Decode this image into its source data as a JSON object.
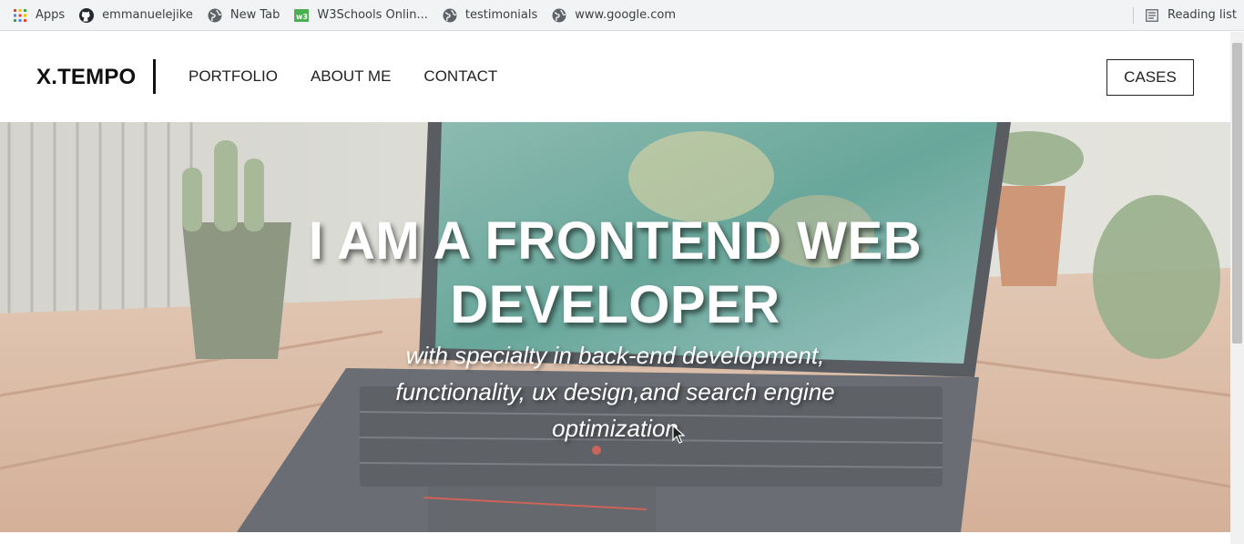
{
  "bookmarks": {
    "items": [
      {
        "label": "Apps",
        "icon": "apps-grid-icon"
      },
      {
        "label": "emmanuelejike",
        "icon": "github-icon"
      },
      {
        "label": "New Tab",
        "icon": "globe-icon"
      },
      {
        "label": "W3Schools Onlin...",
        "icon": "w3schools-icon"
      },
      {
        "label": "testimonials",
        "icon": "globe-icon"
      },
      {
        "label": "www.google.com",
        "icon": "globe-icon"
      }
    ],
    "reading_list": {
      "label": "Reading list",
      "icon": "reading-list-icon"
    }
  },
  "header": {
    "logo": "X.TEMPO",
    "nav": [
      "PORTFOLIO",
      "ABOUT ME",
      "CONTACT"
    ],
    "cta": "CASES"
  },
  "hero": {
    "title_line1": "I AM A FRONTEND WEB",
    "title_line2": "DEVELOPER",
    "subtitle_line1": "with specialty in back-end development,",
    "subtitle_line2": "functionality, ux design,and search engine",
    "subtitle_line3": "optimization"
  },
  "colors": {
    "accent": "#111111",
    "hero_overlay": "#ffffff",
    "w3schools_green": "#4caf50"
  }
}
